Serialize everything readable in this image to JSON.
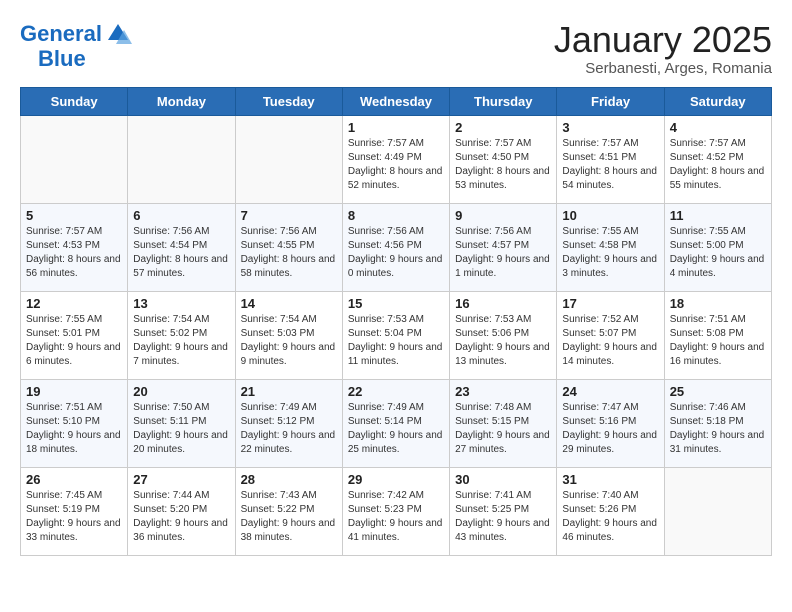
{
  "logo": {
    "general": "General",
    "blue": "Blue"
  },
  "title": "January 2025",
  "subtitle": "Serbanesti, Arges, Romania",
  "days_of_week": [
    "Sunday",
    "Monday",
    "Tuesday",
    "Wednesday",
    "Thursday",
    "Friday",
    "Saturday"
  ],
  "weeks": [
    [
      {
        "day": "",
        "text": ""
      },
      {
        "day": "",
        "text": ""
      },
      {
        "day": "",
        "text": ""
      },
      {
        "day": "1",
        "text": "Sunrise: 7:57 AM\nSunset: 4:49 PM\nDaylight: 8 hours and 52 minutes."
      },
      {
        "day": "2",
        "text": "Sunrise: 7:57 AM\nSunset: 4:50 PM\nDaylight: 8 hours and 53 minutes."
      },
      {
        "day": "3",
        "text": "Sunrise: 7:57 AM\nSunset: 4:51 PM\nDaylight: 8 hours and 54 minutes."
      },
      {
        "day": "4",
        "text": "Sunrise: 7:57 AM\nSunset: 4:52 PM\nDaylight: 8 hours and 55 minutes."
      }
    ],
    [
      {
        "day": "5",
        "text": "Sunrise: 7:57 AM\nSunset: 4:53 PM\nDaylight: 8 hours and 56 minutes."
      },
      {
        "day": "6",
        "text": "Sunrise: 7:56 AM\nSunset: 4:54 PM\nDaylight: 8 hours and 57 minutes."
      },
      {
        "day": "7",
        "text": "Sunrise: 7:56 AM\nSunset: 4:55 PM\nDaylight: 8 hours and 58 minutes."
      },
      {
        "day": "8",
        "text": "Sunrise: 7:56 AM\nSunset: 4:56 PM\nDaylight: 9 hours and 0 minutes."
      },
      {
        "day": "9",
        "text": "Sunrise: 7:56 AM\nSunset: 4:57 PM\nDaylight: 9 hours and 1 minute."
      },
      {
        "day": "10",
        "text": "Sunrise: 7:55 AM\nSunset: 4:58 PM\nDaylight: 9 hours and 3 minutes."
      },
      {
        "day": "11",
        "text": "Sunrise: 7:55 AM\nSunset: 5:00 PM\nDaylight: 9 hours and 4 minutes."
      }
    ],
    [
      {
        "day": "12",
        "text": "Sunrise: 7:55 AM\nSunset: 5:01 PM\nDaylight: 9 hours and 6 minutes."
      },
      {
        "day": "13",
        "text": "Sunrise: 7:54 AM\nSunset: 5:02 PM\nDaylight: 9 hours and 7 minutes."
      },
      {
        "day": "14",
        "text": "Sunrise: 7:54 AM\nSunset: 5:03 PM\nDaylight: 9 hours and 9 minutes."
      },
      {
        "day": "15",
        "text": "Sunrise: 7:53 AM\nSunset: 5:04 PM\nDaylight: 9 hours and 11 minutes."
      },
      {
        "day": "16",
        "text": "Sunrise: 7:53 AM\nSunset: 5:06 PM\nDaylight: 9 hours and 13 minutes."
      },
      {
        "day": "17",
        "text": "Sunrise: 7:52 AM\nSunset: 5:07 PM\nDaylight: 9 hours and 14 minutes."
      },
      {
        "day": "18",
        "text": "Sunrise: 7:51 AM\nSunset: 5:08 PM\nDaylight: 9 hours and 16 minutes."
      }
    ],
    [
      {
        "day": "19",
        "text": "Sunrise: 7:51 AM\nSunset: 5:10 PM\nDaylight: 9 hours and 18 minutes."
      },
      {
        "day": "20",
        "text": "Sunrise: 7:50 AM\nSunset: 5:11 PM\nDaylight: 9 hours and 20 minutes."
      },
      {
        "day": "21",
        "text": "Sunrise: 7:49 AM\nSunset: 5:12 PM\nDaylight: 9 hours and 22 minutes."
      },
      {
        "day": "22",
        "text": "Sunrise: 7:49 AM\nSunset: 5:14 PM\nDaylight: 9 hours and 25 minutes."
      },
      {
        "day": "23",
        "text": "Sunrise: 7:48 AM\nSunset: 5:15 PM\nDaylight: 9 hours and 27 minutes."
      },
      {
        "day": "24",
        "text": "Sunrise: 7:47 AM\nSunset: 5:16 PM\nDaylight: 9 hours and 29 minutes."
      },
      {
        "day": "25",
        "text": "Sunrise: 7:46 AM\nSunset: 5:18 PM\nDaylight: 9 hours and 31 minutes."
      }
    ],
    [
      {
        "day": "26",
        "text": "Sunrise: 7:45 AM\nSunset: 5:19 PM\nDaylight: 9 hours and 33 minutes."
      },
      {
        "day": "27",
        "text": "Sunrise: 7:44 AM\nSunset: 5:20 PM\nDaylight: 9 hours and 36 minutes."
      },
      {
        "day": "28",
        "text": "Sunrise: 7:43 AM\nSunset: 5:22 PM\nDaylight: 9 hours and 38 minutes."
      },
      {
        "day": "29",
        "text": "Sunrise: 7:42 AM\nSunset: 5:23 PM\nDaylight: 9 hours and 41 minutes."
      },
      {
        "day": "30",
        "text": "Sunrise: 7:41 AM\nSunset: 5:25 PM\nDaylight: 9 hours and 43 minutes."
      },
      {
        "day": "31",
        "text": "Sunrise: 7:40 AM\nSunset: 5:26 PM\nDaylight: 9 hours and 46 minutes."
      },
      {
        "day": "",
        "text": ""
      }
    ]
  ]
}
